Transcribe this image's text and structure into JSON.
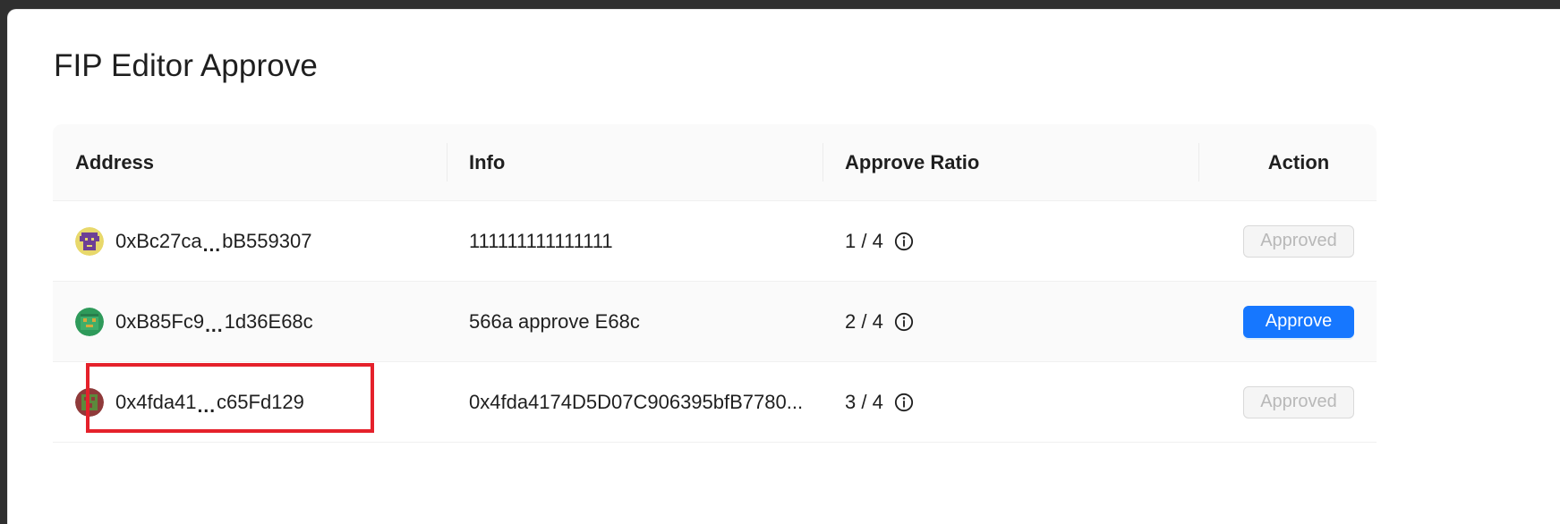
{
  "page": {
    "title": "FIP Editor Approve"
  },
  "table": {
    "columns": {
      "address": "Address",
      "info": "Info",
      "ratio": "Approve Ratio",
      "action": "Action"
    },
    "rows": [
      {
        "address_start": "0xBc27ca",
        "address_dots": "...",
        "address_end": "bB559307",
        "info": "111111111111111",
        "ratio": "1 / 4",
        "action_label": "Approved",
        "action_state": "disabled",
        "avatar_icon": "pixel-avatar-purple-icon"
      },
      {
        "address_start": "0xB85Fc9",
        "address_dots": "...",
        "address_end": "1d36E68c",
        "info": "566a approve E68c",
        "ratio": "2 / 4",
        "action_label": "Approve",
        "action_state": "enabled",
        "avatar_icon": "pixel-avatar-green-icon"
      },
      {
        "address_start": "0x4fda41",
        "address_dots": "...",
        "address_end": "c65Fd129",
        "info": "0x4fda4174D5D07C906395bfB7780...",
        "ratio": "3 / 4",
        "action_label": "Approved",
        "action_state": "disabled",
        "avatar_icon": "pixel-avatar-brown-icon"
      }
    ]
  },
  "colors": {
    "primary": "#1677ff",
    "highlight": "#e5212b",
    "header_bg": "#fafafa"
  },
  "icons": {
    "info": "info-circle-icon"
  }
}
